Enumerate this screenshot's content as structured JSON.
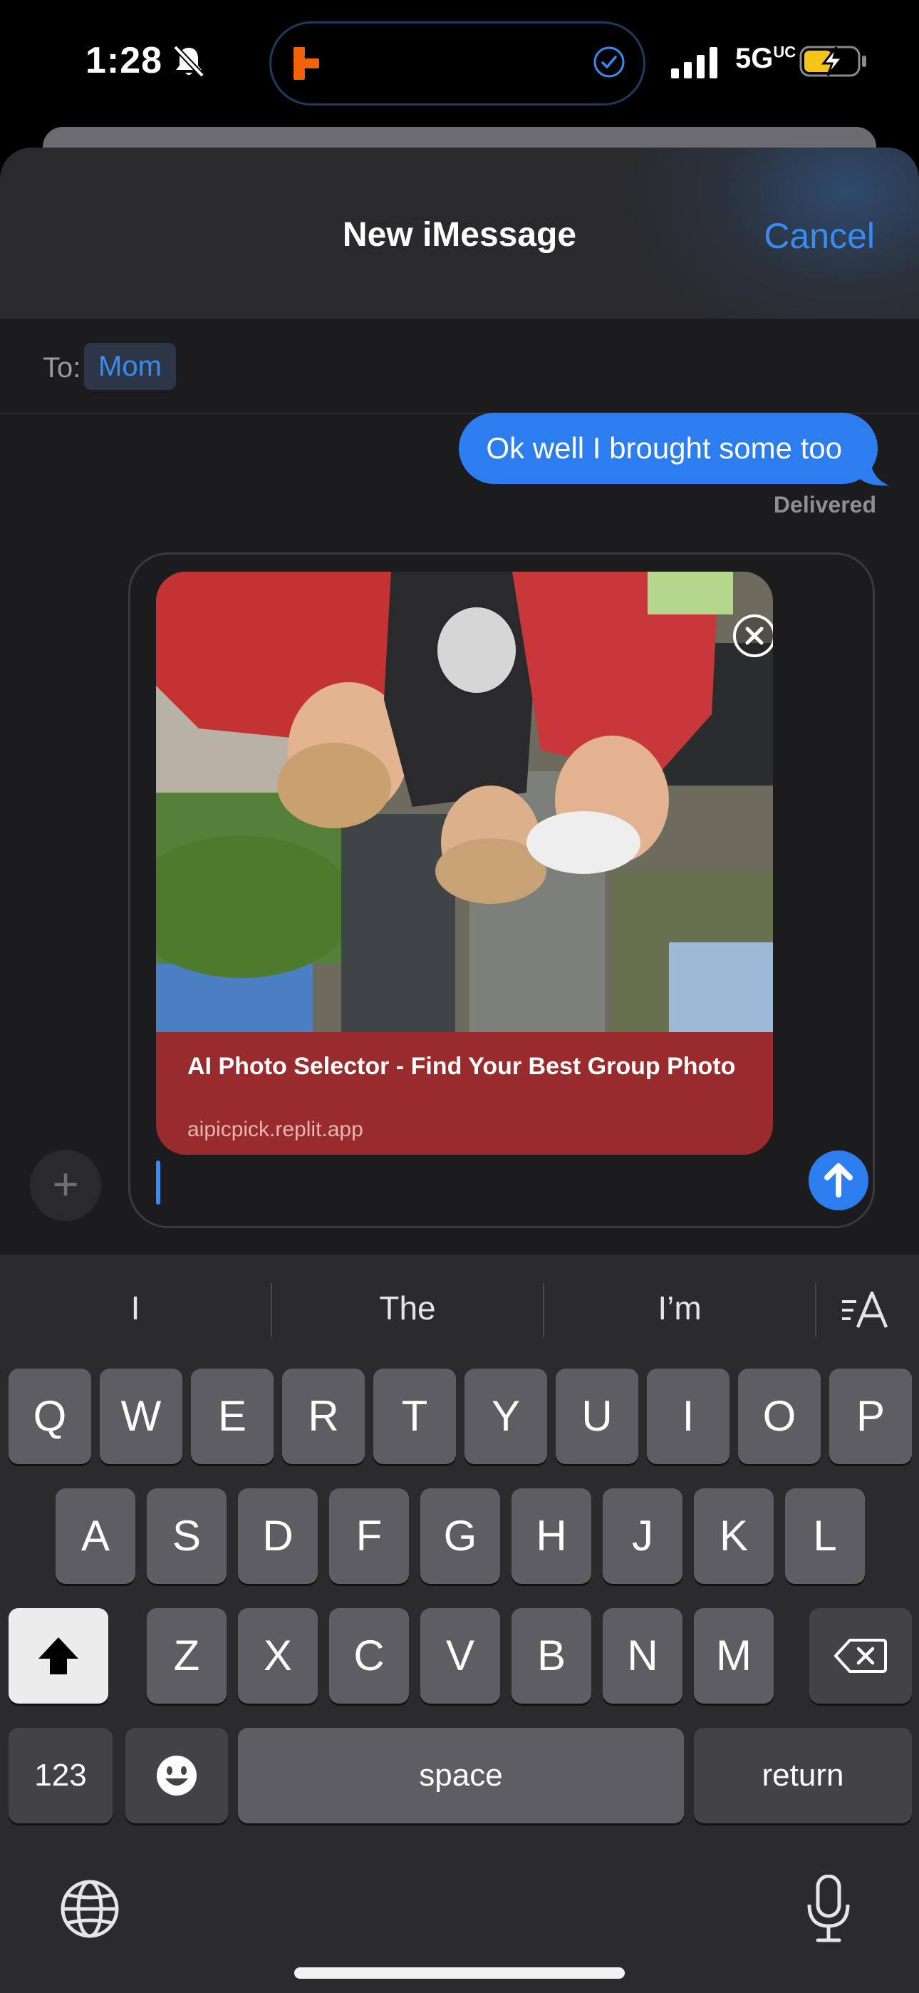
{
  "status": {
    "time": "1:28",
    "network": "5G",
    "network_suffix": "UC"
  },
  "header": {
    "title": "New iMessage",
    "cancel": "Cancel"
  },
  "recipient": {
    "label": "To:",
    "name": "Mom"
  },
  "thread": {
    "last_message": "Ok well I brought some too",
    "status": "Delivered"
  },
  "link_preview": {
    "title": "AI Photo Selector - Find Your Best Group Photo",
    "url": "aipicpick.replit.app"
  },
  "compose": {
    "text": ""
  },
  "keyboard": {
    "predictions": [
      "I",
      "The",
      "I’m"
    ],
    "row1": [
      "Q",
      "W",
      "E",
      "R",
      "T",
      "Y",
      "U",
      "I",
      "O",
      "P"
    ],
    "row2": [
      "A",
      "S",
      "D",
      "F",
      "G",
      "H",
      "J",
      "K",
      "L"
    ],
    "row3": [
      "Z",
      "X",
      "C",
      "V",
      "B",
      "N",
      "M"
    ],
    "numbers_key": "123",
    "space_key": "space",
    "return_key": "return"
  },
  "colors": {
    "accent": "#2c7ef0",
    "link_card": "#9a2b2d",
    "keyboard_bg": "#2b2b2d"
  },
  "icons": [
    "silent-bell-icon",
    "island-app-icon",
    "checkmark-circle-icon",
    "signal-icon",
    "battery-charging-icon",
    "close-circle-icon",
    "send-arrow-icon",
    "plus-icon",
    "shift-icon",
    "delete-icon",
    "emoji-icon",
    "globe-icon",
    "microphone-icon",
    "text-format-icon"
  ]
}
